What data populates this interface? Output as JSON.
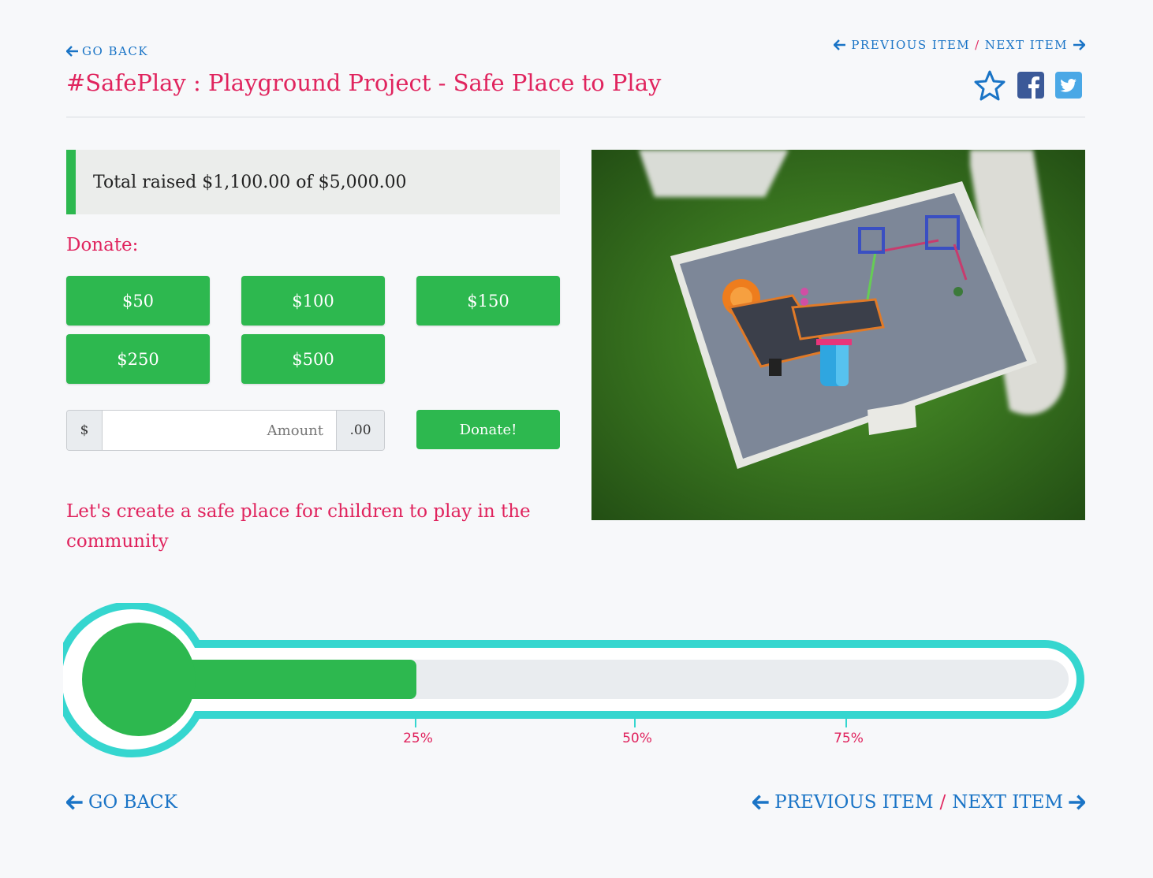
{
  "nav": {
    "back_label": "GO BACK",
    "previous_label": "PREVIOUS ITEM",
    "separator": "/",
    "next_label": "NEXT ITEM"
  },
  "title": "#SafePlay : Playground Project - Safe Place to Play",
  "share_icons": [
    "star-icon",
    "facebook-icon",
    "twitter-icon"
  ],
  "raised": {
    "text": "Total raised $1,100.00 of $5,000.00",
    "amount": 1100,
    "goal": 5000
  },
  "donate": {
    "label": "Donate:",
    "amounts": [
      "$50",
      "$100",
      "$150",
      "$250",
      "$500"
    ],
    "currency_prefix": "$",
    "amount_placeholder": "Amount",
    "cents_suffix": ".00",
    "submit_label": "Donate!"
  },
  "description": "Let's create a safe place for children to play in the community",
  "progress": {
    "fraction": 0.22,
    "ticks": [
      "25%",
      "50%",
      "75%"
    ]
  },
  "colors": {
    "accent_pink": "#e0245e",
    "link_blue": "#1a74c6",
    "green": "#2db84f",
    "teal": "#35d6cf"
  }
}
